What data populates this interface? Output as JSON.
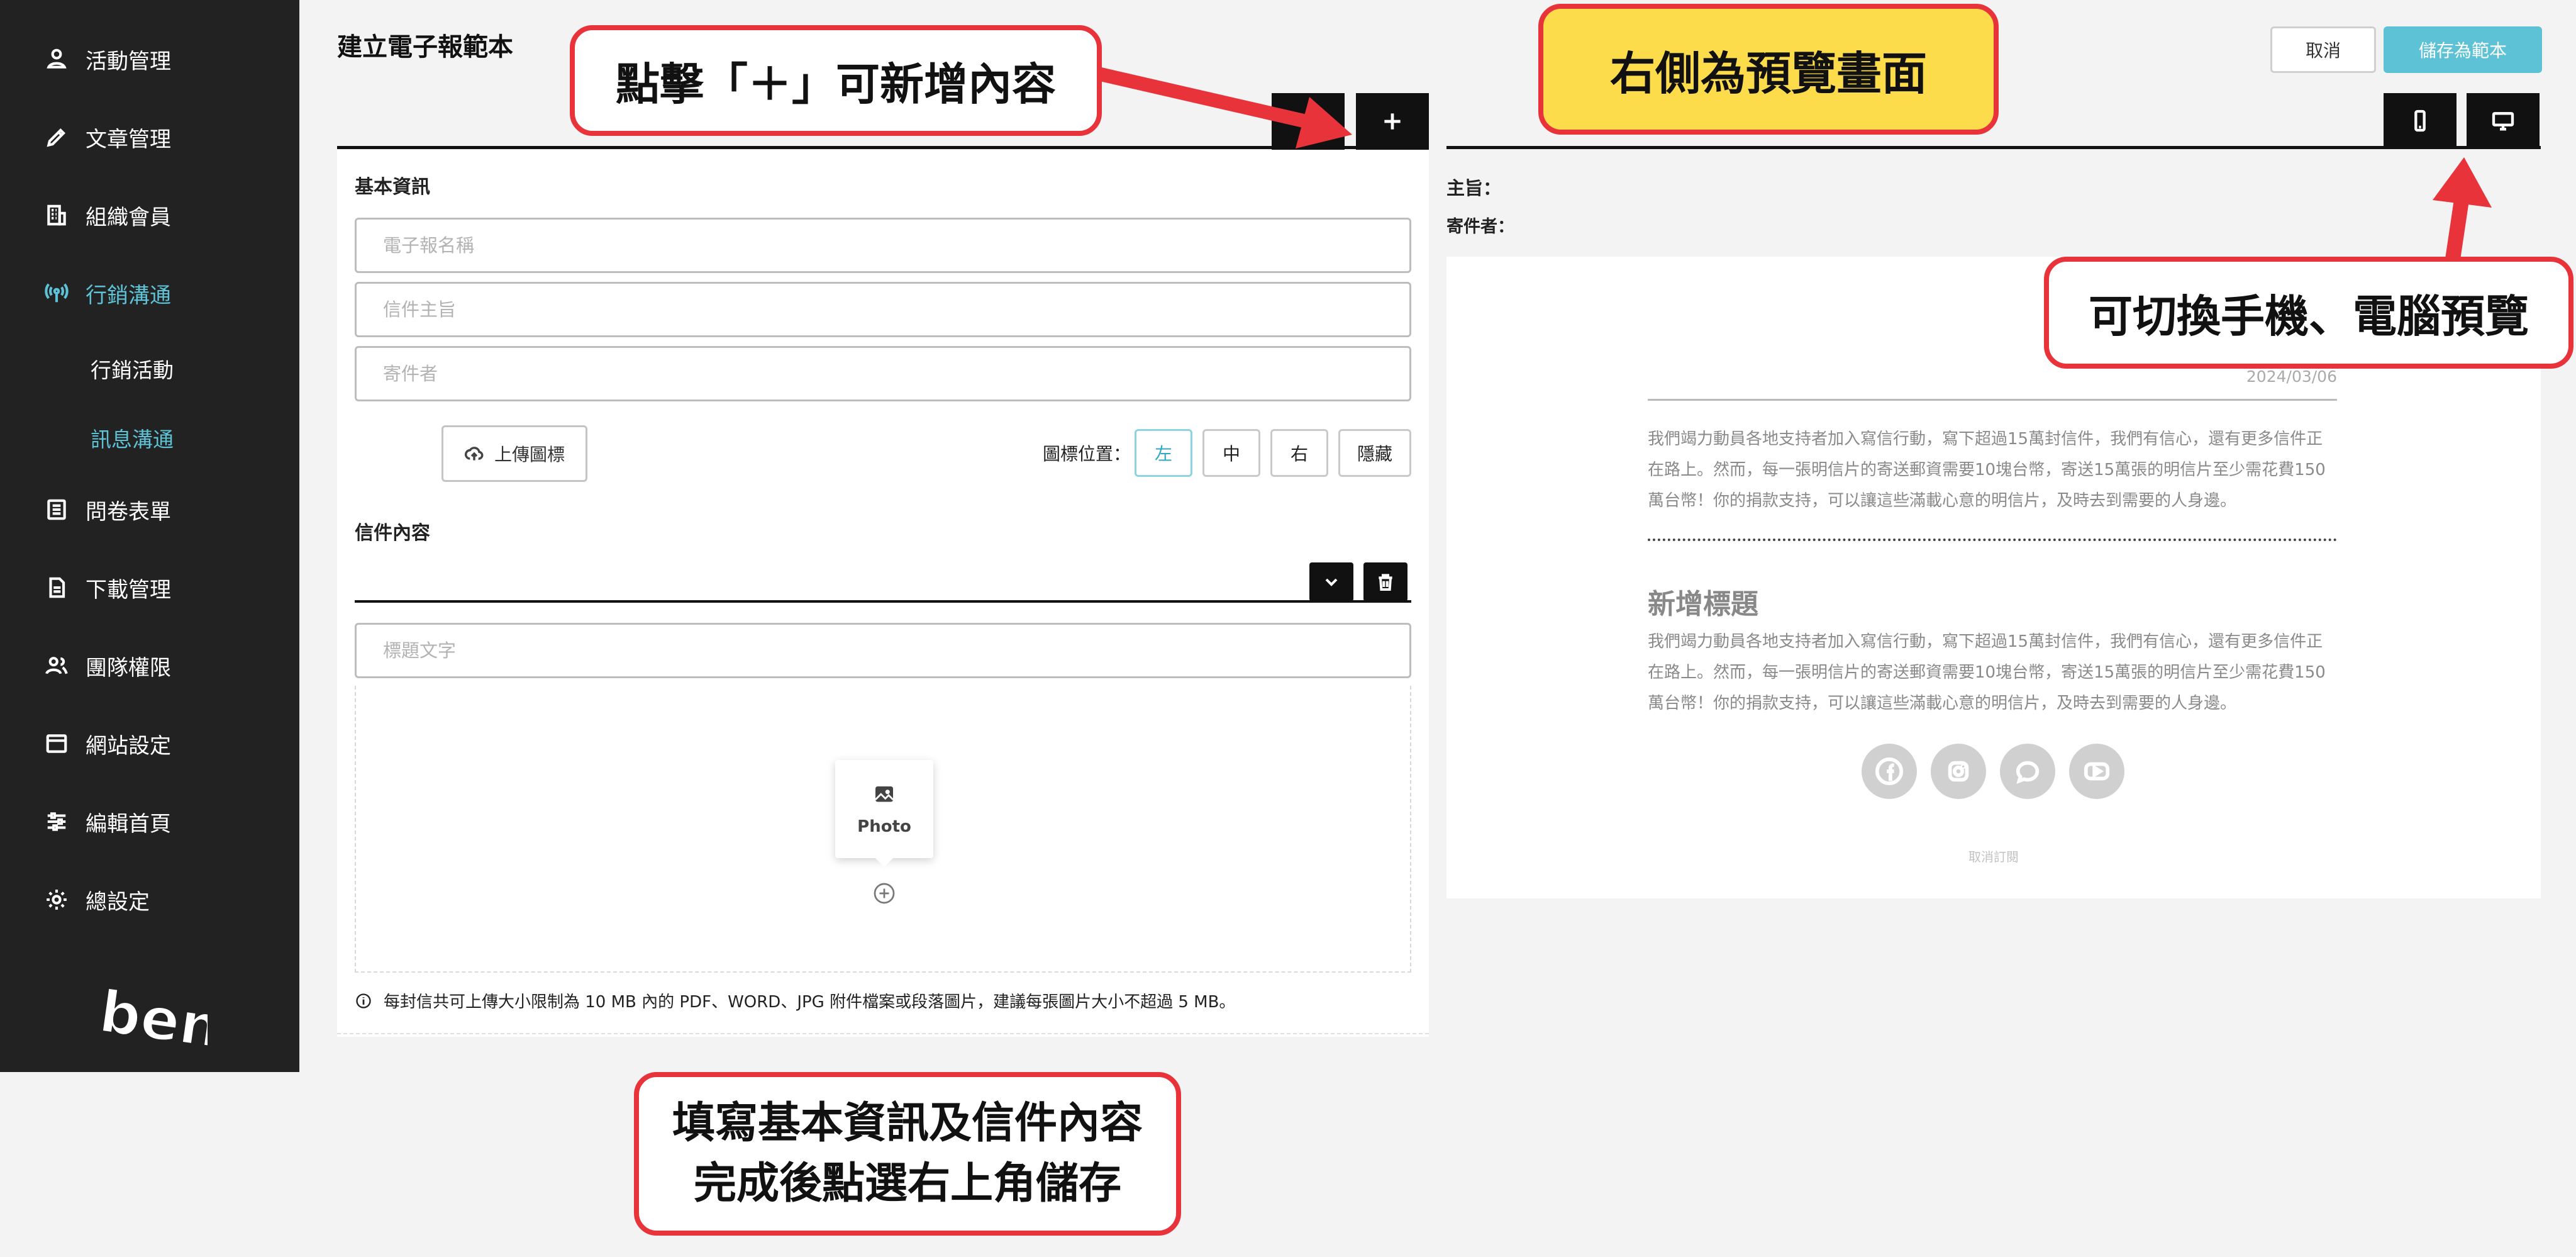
{
  "sidebar": {
    "items": [
      {
        "label": "活動管理",
        "icon": "user-pin-icon"
      },
      {
        "label": "文章管理",
        "icon": "pen-icon"
      },
      {
        "label": "組織會員",
        "icon": "building-icon"
      },
      {
        "label": "行銷溝通",
        "icon": "broadcast-icon",
        "active": true
      },
      {
        "label": "問卷表單",
        "icon": "form-icon"
      },
      {
        "label": "下載管理",
        "icon": "file-icon"
      },
      {
        "label": "團隊權限",
        "icon": "team-icon"
      },
      {
        "label": "網站設定",
        "icon": "window-icon"
      },
      {
        "label": "編輯首頁",
        "icon": "sliders-icon"
      },
      {
        "label": "總設定",
        "icon": "gear-icon"
      }
    ],
    "sub_items": [
      {
        "label": "行銷活動"
      },
      {
        "label": "訊息溝通",
        "active": true
      }
    ],
    "logo_text": "ben"
  },
  "editor": {
    "page_title": "建立電子報範本",
    "basic_info_label": "基本資訊",
    "newsletter_name_placeholder": "電子報名稱",
    "subject_placeholder": "信件主旨",
    "sender_placeholder": "寄件者",
    "upload_icon_label": "上傳圖標",
    "icon_position_label": "圖標位置：",
    "icon_positions": [
      "左",
      "中",
      "右",
      "隱藏"
    ],
    "icon_position_selected": "左",
    "mail_content_label": "信件內容",
    "heading_placeholder": "標題文字",
    "photo_label": "Photo",
    "attachment_note": "每封信共可上傳大小限制為 10 MB 內的 PDF、WORD、JPG 附件檔案或段落圖片，建議每張圖片大小不超過 5 MB。"
  },
  "header_actions": {
    "cancel_label": "取消",
    "save_label": "儲存為範本"
  },
  "preview": {
    "subject_label": "主旨：",
    "sender_label": "寄件者：",
    "date": "2024/03/06",
    "paragraph_1": "我們竭力動員各地支持者加入寫信行動，寫下超過15萬封信件，我們有信心，還有更多信件正在路上。然而，每一張明信片的寄送郵資需要10塊台幣，寄送15萬張的明信片至少需花費150萬台幣！你的捐款支持，可以讓這些滿載心意的明信片，及時去到需要的人身邊。",
    "heading": "新增標題",
    "paragraph_2": "我們竭力動員各地支持者加入寫信行動，寫下超過15萬封信件，我們有信心，還有更多信件正在路上。然而，每一張明信片的寄送郵資需要10塊台幣，寄送15萬張的明信片至少需花費150萬台幣！你的捐款支持，可以讓這些滿載心意的明信片，及時去到需要的人身邊。",
    "social_icons": [
      "facebook-icon",
      "instagram-icon",
      "chat-icon",
      "youtube-icon"
    ],
    "footer": "取消訂閱"
  },
  "annotations": {
    "add_content": "點擊「＋」可新增內容",
    "preview_right": "右側為預覽畫面",
    "device_toggle": "可切換手機、電腦預覽",
    "fill_in_line1": "填寫基本資訊及信件內容",
    "fill_in_line2": "完成後點選右上角儲存"
  },
  "colors": {
    "sidebar_bg": "#222222",
    "accent": "#5ec2d6",
    "annotation_red": "#e8333b",
    "annotation_yellow": "#fddc4b"
  }
}
